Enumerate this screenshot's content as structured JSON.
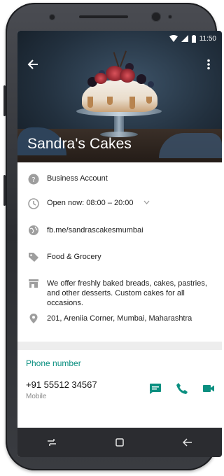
{
  "status_bar": {
    "time": "11:50",
    "icons": [
      "wifi-icon",
      "signal-icon",
      "battery-icon"
    ]
  },
  "app_bar": {
    "back_icon": "arrow-left-icon",
    "menu_icon": "more-vertical-icon"
  },
  "business": {
    "name": "Sandra's Cakes"
  },
  "info_rows": [
    {
      "icon": "help-circle-icon",
      "text": "Business Account"
    },
    {
      "icon": "clock-icon",
      "text": "Open now: 08:00 – 20:00",
      "expand_icon": "chevron-down-icon"
    },
    {
      "icon": "globe-icon",
      "text": "fb.me/sandrascakesmumbai",
      "is_link": true
    },
    {
      "icon": "tag-icon",
      "text": "Food & Grocery"
    },
    {
      "icon": "store-icon",
      "text": "We offer freshly baked breads, cakes, pastries, and other desserts. Custom cakes for all occasions."
    },
    {
      "icon": "location-pin-icon",
      "text": "201, Areniia Corner, Mumbai, Maharashtra"
    }
  ],
  "phone_section": {
    "header": "Phone number",
    "number": "+91 55512 34567",
    "type": "Mobile",
    "actions": [
      "message-icon",
      "phone-icon",
      "video-icon"
    ]
  },
  "nav_bar": {
    "icons": [
      "recent-apps-icon",
      "home-icon",
      "back-icon"
    ]
  },
  "colors": {
    "accent": "#0a8f80",
    "nav_bg": "#2b2c30"
  }
}
